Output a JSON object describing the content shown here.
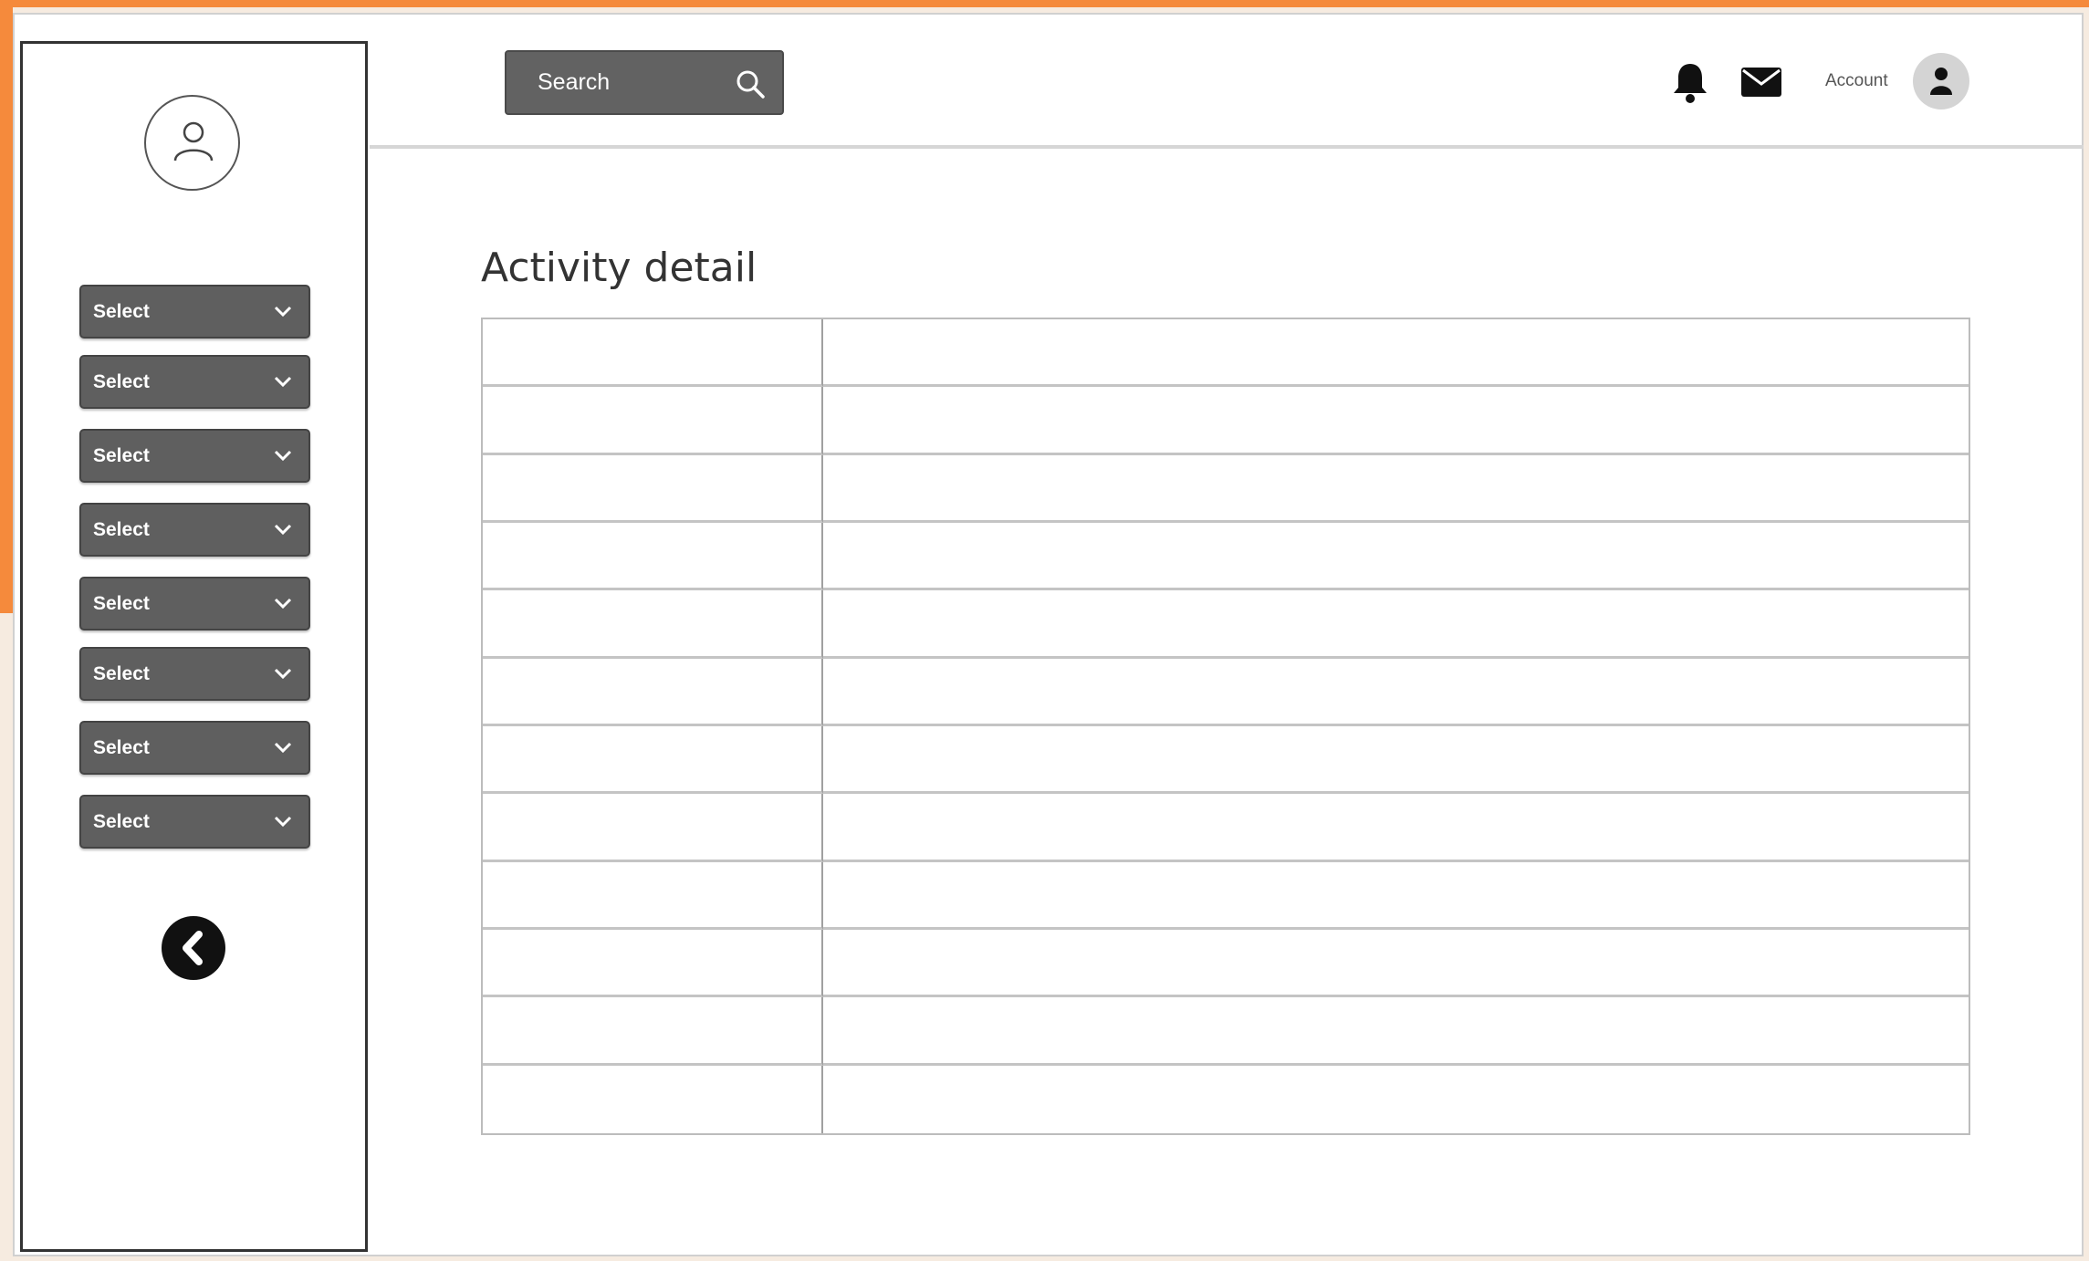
{
  "header": {
    "search_label": "Search",
    "account_label": "Account",
    "icons": [
      "search-icon",
      "bell-icon",
      "mail-icon",
      "user-icon"
    ]
  },
  "sidebar": {
    "selects": [
      {
        "label": "Select"
      },
      {
        "label": "Select"
      },
      {
        "label": "Select"
      },
      {
        "label": "Select"
      },
      {
        "label": "Select"
      },
      {
        "label": "Select"
      },
      {
        "label": "Select"
      },
      {
        "label": "Select"
      }
    ]
  },
  "main": {
    "title": "Activity detail",
    "table_rows": 12
  },
  "colors": {
    "accent_orange": "#f58a3c",
    "button_gray": "#5f5f5f"
  }
}
